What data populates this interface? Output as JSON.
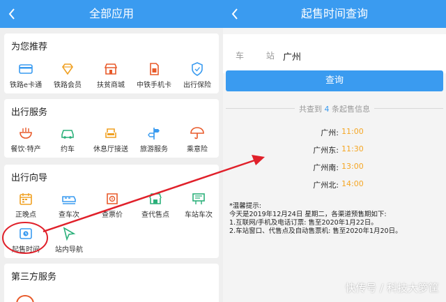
{
  "left": {
    "header": {
      "title": "全部应用"
    },
    "sections": [
      {
        "title": "为您推荐",
        "items": [
          "铁路e卡通",
          "铁路会员",
          "扶贫商城",
          "中铁手机卡",
          "出行保险"
        ]
      },
      {
        "title": "出行服务",
        "items": [
          "餐饮·特产",
          "约车",
          "休息厅接送",
          "旅游服务",
          "乘意险"
        ]
      },
      {
        "title": "出行向导",
        "items": [
          "正晚点",
          "查车次",
          "查票价",
          "查代售点",
          "车站车次",
          "起售时间",
          "站内导航"
        ]
      },
      {
        "title": "第三方服务"
      }
    ]
  },
  "right": {
    "header": {
      "title": "起售时间查询"
    },
    "station": {
      "label": "车 站",
      "value": "广州"
    },
    "query_button": "查询",
    "summary": {
      "prefix": "共查到 ",
      "count": "4",
      "suffix": " 条起售信息"
    },
    "results": [
      {
        "station": "广州:",
        "time": "11:00"
      },
      {
        "station": "广州东:",
        "time": "11:30"
      },
      {
        "station": "广州南:",
        "time": "13:00"
      },
      {
        "station": "广州北:",
        "time": "14:00"
      }
    ],
    "tips": {
      "title": "*温馨提示:",
      "line1": "今天是2019年12月24日 星期二，各渠道预售期如下:",
      "line2": "1.互联网/手机及电话订票: 售至2020年1月22日。",
      "line3": "2.车站窗口、代售点及自动售票机: 售至2020年1月20日。"
    }
  },
  "watermark": "快传号 / 科技大箩筐",
  "colors": {
    "accent": "#3a9bf0",
    "time": "#f5a623",
    "annotation": "#e0202a"
  }
}
